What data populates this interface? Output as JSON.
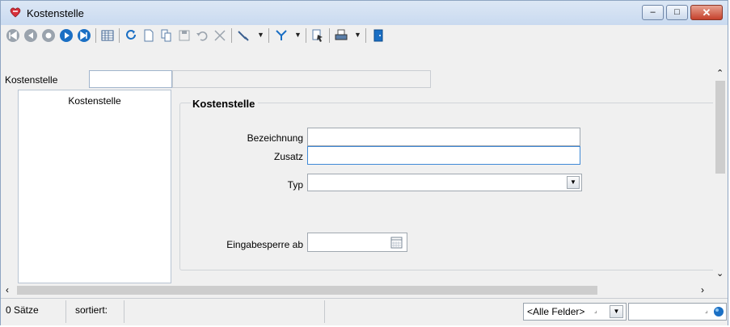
{
  "window": {
    "title": "Kostenstelle",
    "controls": {
      "minimize": "–",
      "maximize": "□",
      "close": "✕"
    }
  },
  "toolbar": {
    "icons": [
      "first-record",
      "previous-record",
      "next-record-gray",
      "next-record",
      "last-record",
      "table-view",
      "refresh",
      "new-record",
      "copy-record",
      "save",
      "undo",
      "delete",
      "tools-dropdown",
      "filter-dropdown",
      "select",
      "print-dropdown",
      "exit"
    ]
  },
  "filter": {
    "label": "Kostenstelle",
    "value": ""
  },
  "list": {
    "header": "Kostenstelle",
    "rows": []
  },
  "form": {
    "group_title": "Kostenstelle",
    "fields": {
      "bezeichnung_label": "Bezeichnung",
      "bezeichnung_value": "",
      "zusatz_label": "Zusatz",
      "zusatz_value": "",
      "typ_label": "Typ",
      "typ_value": "",
      "eingabesperre_label": "Eingabesperre ab",
      "eingabesperre_value": ""
    }
  },
  "status": {
    "count": "0 Sätze",
    "sort": "sortiert:",
    "field_filter": "<Alle Felder>",
    "search_value": ""
  },
  "colors": {
    "titlebar": "#c9daf0",
    "accent_blue": "#1a6fc4",
    "close_red": "#c5412c"
  }
}
